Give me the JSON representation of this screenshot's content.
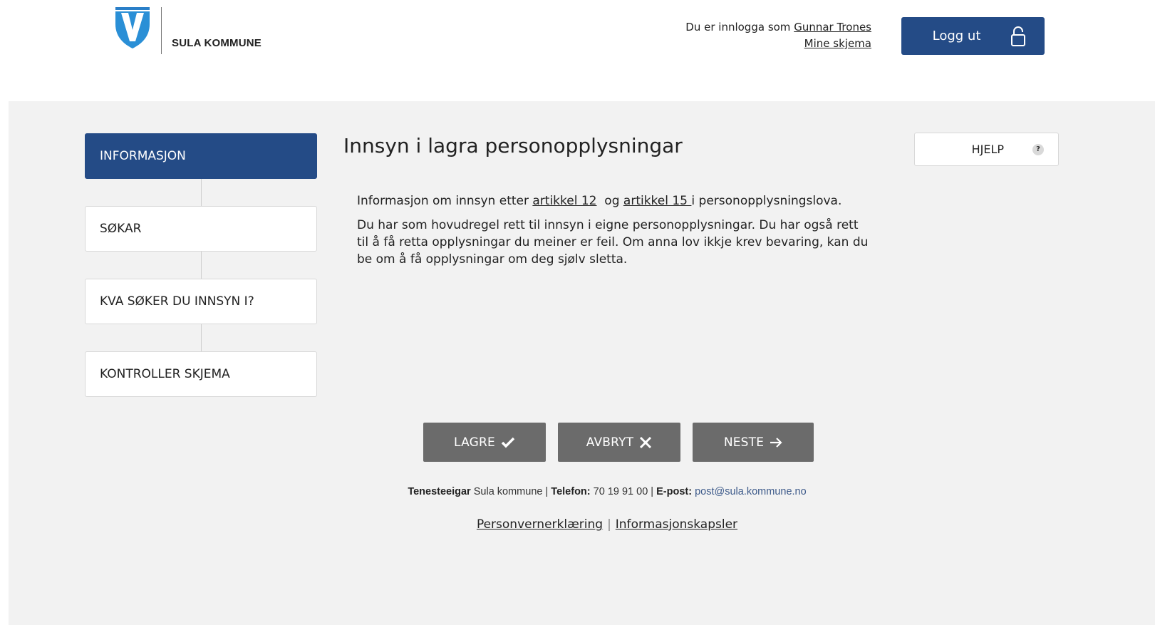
{
  "header": {
    "org_name": "SULA KOMMUNE",
    "logged_in_prefix": "Du er innlogga som",
    "user_name": "Gunnar Trones",
    "my_forms_label": "Mine skjema",
    "logout_label": "Logg ut"
  },
  "colors": {
    "primary": "#244b86",
    "panel_bg": "#f2f2f2",
    "action_button": "#6b6b6b"
  },
  "steps": [
    {
      "label": "INFORMASJON",
      "active": true
    },
    {
      "label": "SØKAR",
      "active": false
    },
    {
      "label": "KVA SØKER DU INNSYN I?",
      "active": false
    },
    {
      "label": "KONTROLLER SKJEMA",
      "active": false
    }
  ],
  "content": {
    "title": "Innsyn i lagra personopplysningar",
    "help_label": "HJELP",
    "help_icon": "?",
    "para1_before": "Informasjon om innsyn etter ",
    "para1_link1": "artikkel 12",
    "para1_middle": "  og ",
    "para1_link2": "artikkel 15 ",
    "para1_after": "i personopplysningslova.",
    "para2": "Du har som hovudregel rett til innsyn i eigne personopplysningar. Du har også rett til å få retta opplysningar du meiner er feil. Om anna lov ikkje krev bevaring, kan du be om å få opplysningar om deg sjølv sletta."
  },
  "actions": {
    "save_label": "LAGRE",
    "cancel_label": "AVBRYT",
    "next_label": "NESTE"
  },
  "footer": {
    "owner_label": "Tenesteeigar",
    "owner_value": "Sula kommune",
    "phone_label": "Telefon",
    "phone_value": "70 19 91 00",
    "email_label": "E-post",
    "email_value": "post@sula.kommune.no",
    "privacy_link": "Personvernerklæring",
    "cookies_link": "Informasjonskapsler",
    "separator": "|"
  }
}
